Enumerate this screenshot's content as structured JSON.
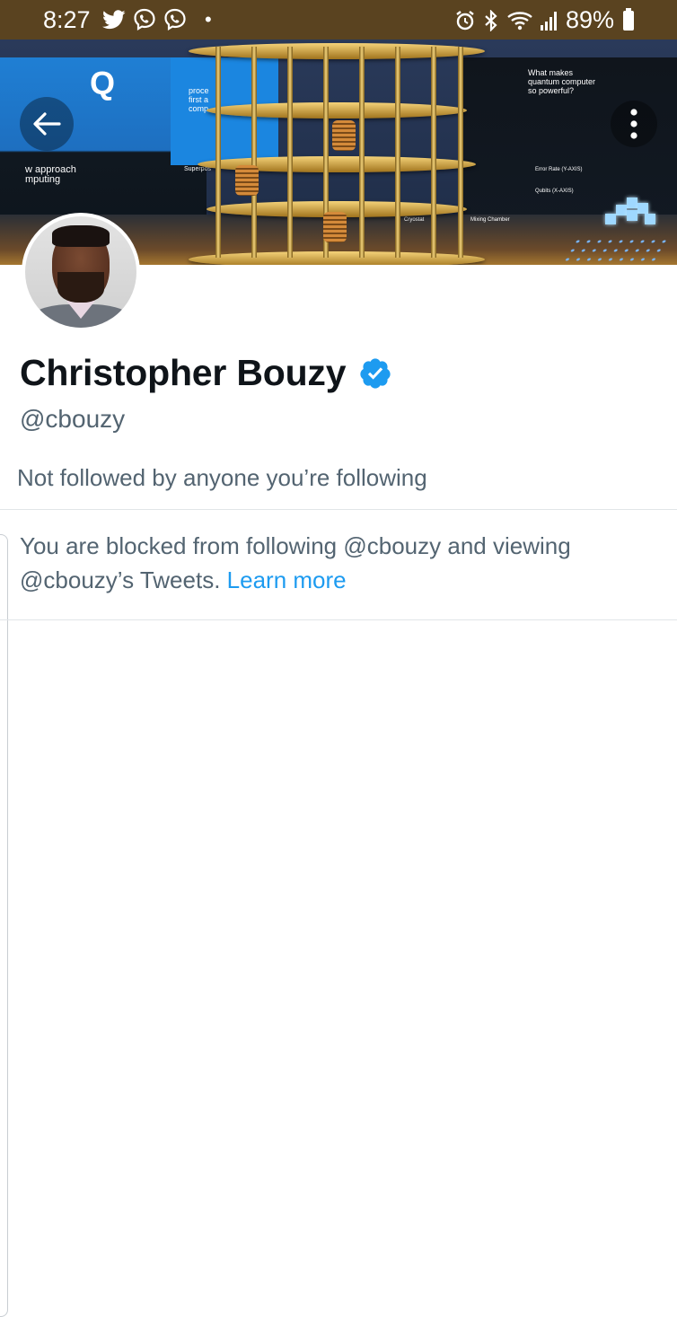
{
  "status_bar": {
    "time": "8:27",
    "battery": "89%",
    "left_icons": [
      "twitter-icon",
      "viber-icon",
      "viber-icon",
      "notification-dot"
    ],
    "right_icons": [
      "alarm-icon",
      "bluetooth-icon",
      "wifi-icon",
      "signal-icon",
      "battery-icon"
    ]
  },
  "header": {
    "back_icon": "arrow-left-icon",
    "more_icon": "vertical-dots-icon"
  },
  "banner": {
    "texts": {
      "q": "Q",
      "what_makes": "What makes",
      "quantum_computer": "quantum computer",
      "so_powerful": "so powerful?",
      "approach": "w approach",
      "computing": "mputing",
      "proc": "proce",
      "first": "first a",
      "comp": "comp",
      "superpos": "Superpos",
      "error_rate": "Error Rate (Y-AXIS)",
      "qubits": "Qubits (X-AXIS)",
      "cryostat": "Cryostat ",
      "mixing_chamber": "Mixing Chamber"
    }
  },
  "profile": {
    "display_name": "Christopher Bouzy",
    "verified": true,
    "handle": "@cbouzy",
    "followers_note": "Not followed by anyone you’re following"
  },
  "blocked": {
    "message": "You are blocked from following @cbouzy and viewing @cbouzy’s Tweets.",
    "link_label": "Learn more"
  },
  "colors": {
    "status_bar": "#5a4320",
    "text_primary": "#0f1419",
    "text_secondary": "#536471",
    "link": "#1d9bf0",
    "verified": "#1d9bf0"
  }
}
